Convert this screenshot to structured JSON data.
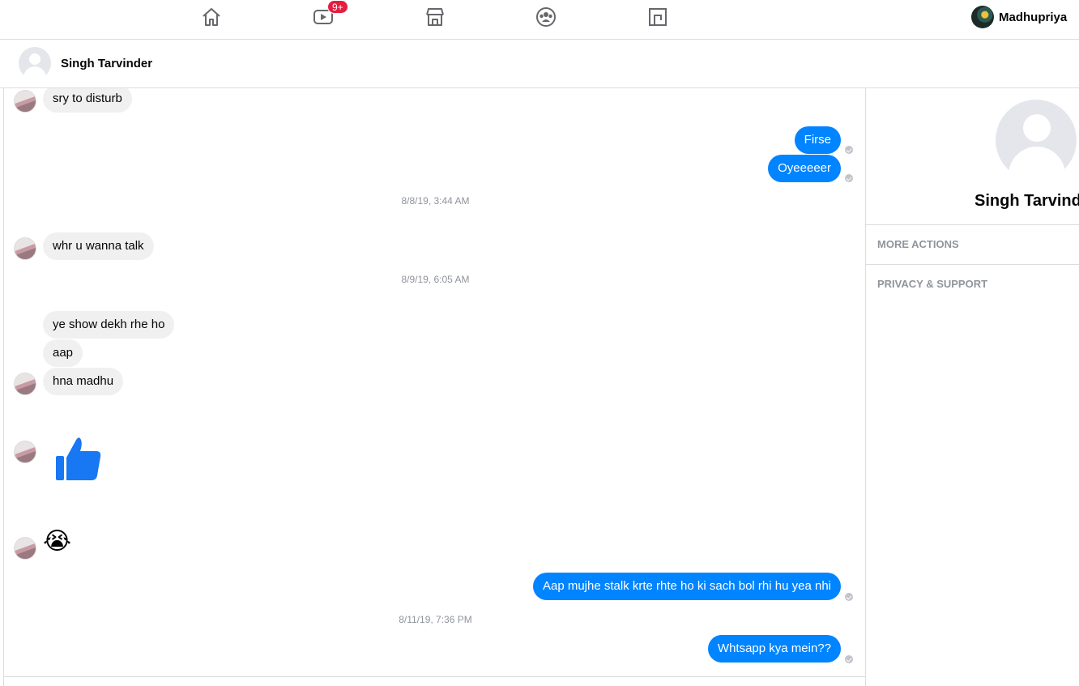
{
  "topnav": {
    "icons": [
      "home-icon",
      "watch-icon",
      "marketplace-icon",
      "groups-icon",
      "gaming-icon"
    ],
    "watch_badge": "9+",
    "profile_name": "Madhupriya"
  },
  "conversation": {
    "contact_name": "Singh Tarvinder"
  },
  "messages": [
    {
      "from": "them",
      "text": "sry to disturb"
    },
    {
      "from": "me",
      "text": "Firse"
    },
    {
      "from": "me",
      "text": "Oyeeeeer"
    },
    {
      "stamp": "8/8/19, 3:44 AM"
    },
    {
      "from": "them",
      "text": "whr u wanna talk"
    },
    {
      "stamp": "8/9/19, 6:05 AM"
    },
    {
      "from": "them",
      "text": "ye show dekh rhe ho"
    },
    {
      "from": "them",
      "text": "aap"
    },
    {
      "from": "them",
      "text": "hna madhu"
    },
    {
      "from": "them",
      "sticker": "thumbs-up"
    },
    {
      "from": "them",
      "emoji": "😭"
    },
    {
      "from": "me",
      "text": "Aap mujhe stalk krte rhte ho ki sach bol rhi hu yea nhi"
    },
    {
      "stamp": "8/11/19, 7:36 PM"
    },
    {
      "from": "me",
      "text": "Whtsapp kya mein??"
    }
  ],
  "info_panel": {
    "name": "Singh Tarvinder",
    "sections": [
      "MORE ACTIONS",
      "PRIVACY & SUPPORT"
    ]
  },
  "colors": {
    "accent": "#0084ff",
    "incoming_bubble": "#f1f0f0",
    "badge": "#e41e3f",
    "muted_text": "#90949c"
  }
}
